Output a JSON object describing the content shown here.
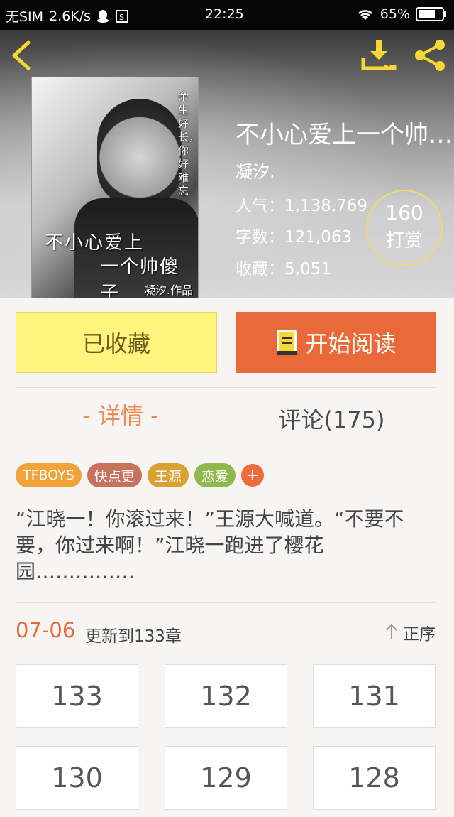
{
  "status_bar": {
    "carrier": "无SIM",
    "speed": "2.6K/s",
    "time": "22:25",
    "battery": "65%"
  },
  "header": {
    "back_icon": "chevron-left-icon",
    "download_icon": "download-icon",
    "share_icon": "share-icon"
  },
  "cover": {
    "vertical_text": "余生好长，你好难忘",
    "title_line1": "不小心爱上",
    "title_line2": "一个帅傻子",
    "author_mark": "凝汐.作品"
  },
  "book": {
    "title": "不小心爱上一个帅傻子",
    "author": "凝汐.",
    "popularity": "人气：1,138,769",
    "word_count": "字数：121,063",
    "favorites": "收藏：5,051"
  },
  "reward": {
    "count": "160",
    "label": "打赏"
  },
  "actions": {
    "collected_label": "已收藏",
    "read_label": "开始阅读"
  },
  "tabs": {
    "detail": "- 详情 -",
    "comments": "评论(175)"
  },
  "tags": [
    {
      "label": "TFBOYS",
      "color": "#f2a33a"
    },
    {
      "label": "快点更",
      "color": "#c8715c"
    },
    {
      "label": "王源",
      "color": "#d9a032"
    },
    {
      "label": "恋爱",
      "color": "#8fb94a"
    }
  ],
  "tag_more": "+",
  "synopsis": "“江晓一！你滚过来！”王源大喊道。“不要不要，你过来啊！”江晓一跑进了樱花园……………",
  "update": {
    "date": "07-06",
    "text": "更新到133章",
    "sort_label": "正序"
  },
  "chapters": [
    "133",
    "132",
    "131",
    "130",
    "129",
    "128"
  ],
  "colors": {
    "accent": "#e96938",
    "collected_bg": "#fff57e",
    "tab_active": "#ef8a55"
  }
}
